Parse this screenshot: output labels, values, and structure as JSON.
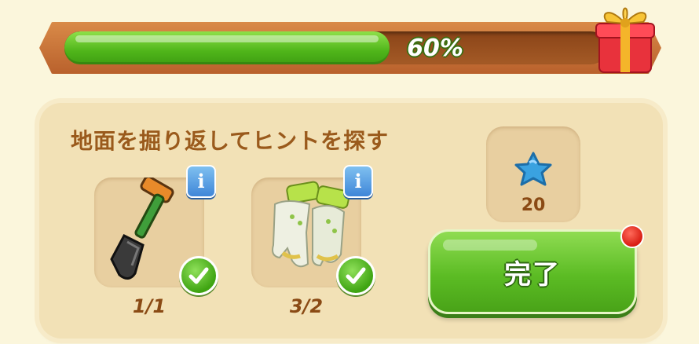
{
  "progress": {
    "percent_label": "60%",
    "fraction": 0.6
  },
  "task": {
    "title": "地面を掘り返してヒントを探す",
    "items": [
      {
        "icon": "shovel-icon",
        "count": "1/1",
        "completed": true
      },
      {
        "icon": "gloves-icon",
        "count": "3/2",
        "completed": true
      }
    ]
  },
  "reward": {
    "icon": "blue-star-icon",
    "value": "20"
  },
  "complete_button": {
    "label": "完了"
  },
  "colors": {
    "progress_green": "#5cbc24",
    "frame_orange": "#c06a30",
    "text_brown": "#9a5a1c"
  }
}
